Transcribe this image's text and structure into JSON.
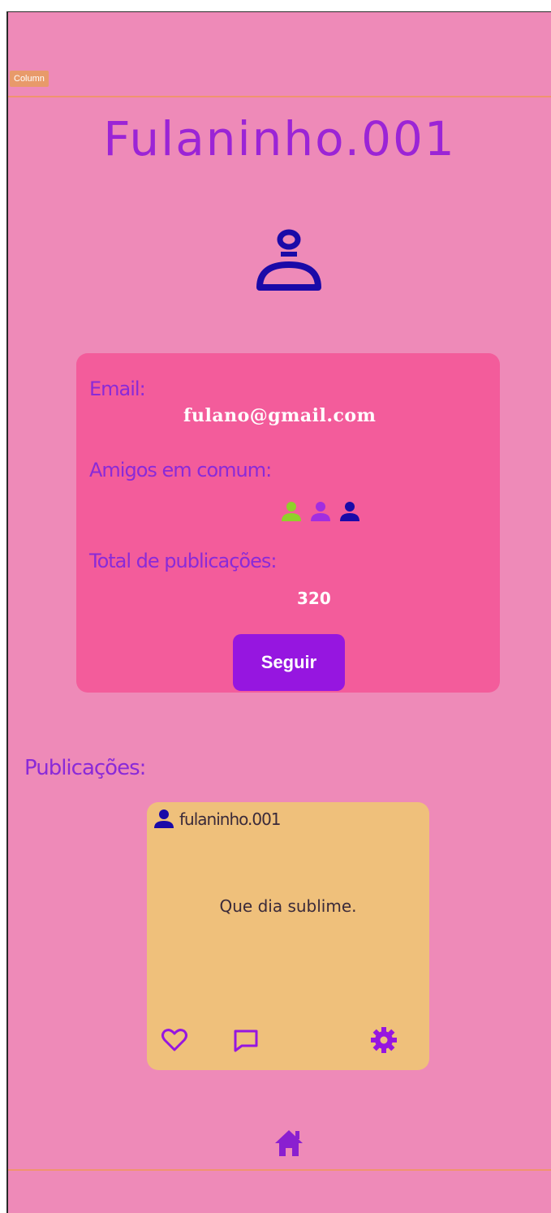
{
  "editor": {
    "column_tag": "Column"
  },
  "profile": {
    "username_title": "Fulaninho.001",
    "avatar_icon": "user-icon"
  },
  "info_card": {
    "email_label": "Email:",
    "email_value": "fulano@gmail.com",
    "friends_label": "Amigos em comum:",
    "friends": [
      {
        "icon": "user-icon",
        "color": "#8fd12a"
      },
      {
        "icon": "user-icon",
        "color": "#a22ee0"
      },
      {
        "icon": "user-icon",
        "color": "#1a0aa8"
      }
    ],
    "total_label": "Total de publicações:",
    "total_value": "320",
    "follow_label": "Seguir"
  },
  "publications": {
    "title": "Publicações:",
    "posts": [
      {
        "user": "fulaninho.001",
        "text": "Que dia sublime.",
        "actions": [
          "heart-icon",
          "comment-icon",
          "gear-icon"
        ]
      }
    ]
  },
  "bottom_nav": {
    "home_icon": "home-icon"
  },
  "colors": {
    "background": "#ee8ab8",
    "card": "#f35c9b",
    "accent": "#9616e0",
    "post": "#efc07b",
    "icon": "#1a0aa8"
  }
}
